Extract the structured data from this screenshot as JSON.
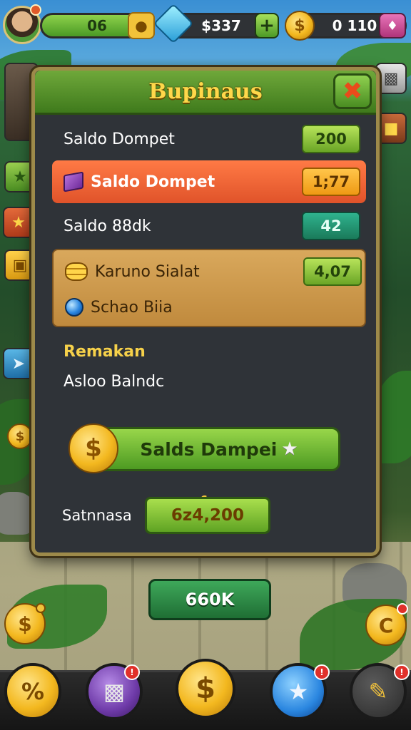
{
  "hud": {
    "level_value": "06",
    "money_value": "$337",
    "coins_value": "0 110",
    "plus_label": "+"
  },
  "panel": {
    "title": "Bupinaus",
    "rows": [
      {
        "label": "Saldo Dompet",
        "value": "200"
      },
      {
        "label": "Saldo Dompet",
        "value": "1;77"
      },
      {
        "label": "Saldo 88dk",
        "value": "42"
      }
    ],
    "gold_rows": [
      {
        "label": "Karuno Sialat",
        "value": "4,07"
      },
      {
        "label": "Schao Biia"
      }
    ],
    "section_title": "Remakan",
    "section_sub": "Asloo Balndc",
    "main_button": "Salds Dampei",
    "summary_label": "Satnnasa",
    "summary_value": "6z4,200",
    "summary_coin": "c"
  },
  "outer_button": "660K",
  "colors": {
    "panel_bg": "#2f3338",
    "title_gold": "#ffd84a",
    "accent_green": "#6aa526",
    "highlight_orange": "#e0532a",
    "teal_value": "#1a7a5a"
  },
  "icons": [
    "avatar",
    "lightbulb-icon",
    "gem-icon",
    "coin-icon",
    "shop-icon",
    "close-icon",
    "gift-icon",
    "coin-stack-icon",
    "orb-icon",
    "star-icon",
    "percent-icon",
    "trash-can-icon",
    "star-badge-icon",
    "pencil-icon"
  ]
}
